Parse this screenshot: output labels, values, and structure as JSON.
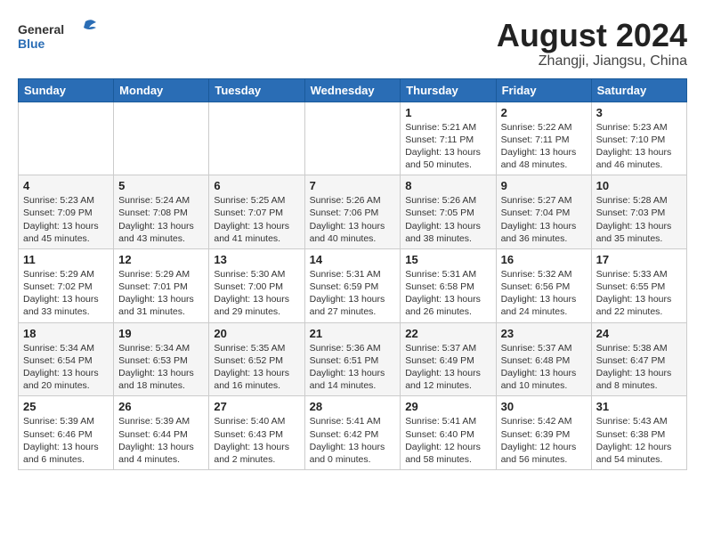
{
  "header": {
    "logo_line1": "General",
    "logo_line2": "Blue",
    "month_year": "August 2024",
    "location": "Zhangji, Jiangsu, China"
  },
  "weekdays": [
    "Sunday",
    "Monday",
    "Tuesday",
    "Wednesday",
    "Thursday",
    "Friday",
    "Saturday"
  ],
  "weeks": [
    [
      {
        "day": "",
        "info": ""
      },
      {
        "day": "",
        "info": ""
      },
      {
        "day": "",
        "info": ""
      },
      {
        "day": "",
        "info": ""
      },
      {
        "day": "1",
        "info": "Sunrise: 5:21 AM\nSunset: 7:11 PM\nDaylight: 13 hours\nand 50 minutes."
      },
      {
        "day": "2",
        "info": "Sunrise: 5:22 AM\nSunset: 7:11 PM\nDaylight: 13 hours\nand 48 minutes."
      },
      {
        "day": "3",
        "info": "Sunrise: 5:23 AM\nSunset: 7:10 PM\nDaylight: 13 hours\nand 46 minutes."
      }
    ],
    [
      {
        "day": "4",
        "info": "Sunrise: 5:23 AM\nSunset: 7:09 PM\nDaylight: 13 hours\nand 45 minutes."
      },
      {
        "day": "5",
        "info": "Sunrise: 5:24 AM\nSunset: 7:08 PM\nDaylight: 13 hours\nand 43 minutes."
      },
      {
        "day": "6",
        "info": "Sunrise: 5:25 AM\nSunset: 7:07 PM\nDaylight: 13 hours\nand 41 minutes."
      },
      {
        "day": "7",
        "info": "Sunrise: 5:26 AM\nSunset: 7:06 PM\nDaylight: 13 hours\nand 40 minutes."
      },
      {
        "day": "8",
        "info": "Sunrise: 5:26 AM\nSunset: 7:05 PM\nDaylight: 13 hours\nand 38 minutes."
      },
      {
        "day": "9",
        "info": "Sunrise: 5:27 AM\nSunset: 7:04 PM\nDaylight: 13 hours\nand 36 minutes."
      },
      {
        "day": "10",
        "info": "Sunrise: 5:28 AM\nSunset: 7:03 PM\nDaylight: 13 hours\nand 35 minutes."
      }
    ],
    [
      {
        "day": "11",
        "info": "Sunrise: 5:29 AM\nSunset: 7:02 PM\nDaylight: 13 hours\nand 33 minutes."
      },
      {
        "day": "12",
        "info": "Sunrise: 5:29 AM\nSunset: 7:01 PM\nDaylight: 13 hours\nand 31 minutes."
      },
      {
        "day": "13",
        "info": "Sunrise: 5:30 AM\nSunset: 7:00 PM\nDaylight: 13 hours\nand 29 minutes."
      },
      {
        "day": "14",
        "info": "Sunrise: 5:31 AM\nSunset: 6:59 PM\nDaylight: 13 hours\nand 27 minutes."
      },
      {
        "day": "15",
        "info": "Sunrise: 5:31 AM\nSunset: 6:58 PM\nDaylight: 13 hours\nand 26 minutes."
      },
      {
        "day": "16",
        "info": "Sunrise: 5:32 AM\nSunset: 6:56 PM\nDaylight: 13 hours\nand 24 minutes."
      },
      {
        "day": "17",
        "info": "Sunrise: 5:33 AM\nSunset: 6:55 PM\nDaylight: 13 hours\nand 22 minutes."
      }
    ],
    [
      {
        "day": "18",
        "info": "Sunrise: 5:34 AM\nSunset: 6:54 PM\nDaylight: 13 hours\nand 20 minutes."
      },
      {
        "day": "19",
        "info": "Sunrise: 5:34 AM\nSunset: 6:53 PM\nDaylight: 13 hours\nand 18 minutes."
      },
      {
        "day": "20",
        "info": "Sunrise: 5:35 AM\nSunset: 6:52 PM\nDaylight: 13 hours\nand 16 minutes."
      },
      {
        "day": "21",
        "info": "Sunrise: 5:36 AM\nSunset: 6:51 PM\nDaylight: 13 hours\nand 14 minutes."
      },
      {
        "day": "22",
        "info": "Sunrise: 5:37 AM\nSunset: 6:49 PM\nDaylight: 13 hours\nand 12 minutes."
      },
      {
        "day": "23",
        "info": "Sunrise: 5:37 AM\nSunset: 6:48 PM\nDaylight: 13 hours\nand 10 minutes."
      },
      {
        "day": "24",
        "info": "Sunrise: 5:38 AM\nSunset: 6:47 PM\nDaylight: 13 hours\nand 8 minutes."
      }
    ],
    [
      {
        "day": "25",
        "info": "Sunrise: 5:39 AM\nSunset: 6:46 PM\nDaylight: 13 hours\nand 6 minutes."
      },
      {
        "day": "26",
        "info": "Sunrise: 5:39 AM\nSunset: 6:44 PM\nDaylight: 13 hours\nand 4 minutes."
      },
      {
        "day": "27",
        "info": "Sunrise: 5:40 AM\nSunset: 6:43 PM\nDaylight: 13 hours\nand 2 minutes."
      },
      {
        "day": "28",
        "info": "Sunrise: 5:41 AM\nSunset: 6:42 PM\nDaylight: 13 hours\nand 0 minutes."
      },
      {
        "day": "29",
        "info": "Sunrise: 5:41 AM\nSunset: 6:40 PM\nDaylight: 12 hours\nand 58 minutes."
      },
      {
        "day": "30",
        "info": "Sunrise: 5:42 AM\nSunset: 6:39 PM\nDaylight: 12 hours\nand 56 minutes."
      },
      {
        "day": "31",
        "info": "Sunrise: 5:43 AM\nSunset: 6:38 PM\nDaylight: 12 hours\nand 54 minutes."
      }
    ]
  ]
}
